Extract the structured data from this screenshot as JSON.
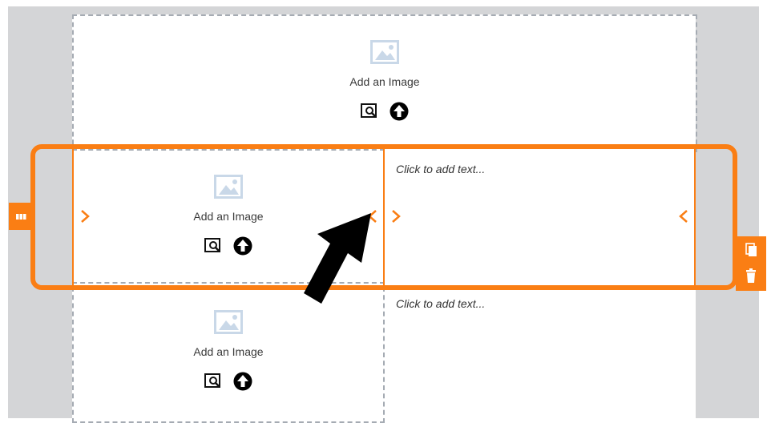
{
  "image_blocks": [
    {
      "label": "Add an Image"
    },
    {
      "label": "Add an Image"
    },
    {
      "label": "Add an Image"
    }
  ],
  "text_blocks": [
    {
      "placeholder": "Click to add text..."
    },
    {
      "placeholder": "Click to add text..."
    }
  ],
  "colors": {
    "accent": "#fa7e14",
    "background": "#d4d5d7",
    "placeholder_icon": "#c9d8e8"
  },
  "icons": [
    "image-placeholder-icon",
    "browse-image-icon",
    "upload-arrow-icon",
    "columns-icon",
    "copy-icon",
    "trash-icon",
    "chevron-right-icon",
    "chevron-left-icon",
    "pointer-arrow"
  ]
}
